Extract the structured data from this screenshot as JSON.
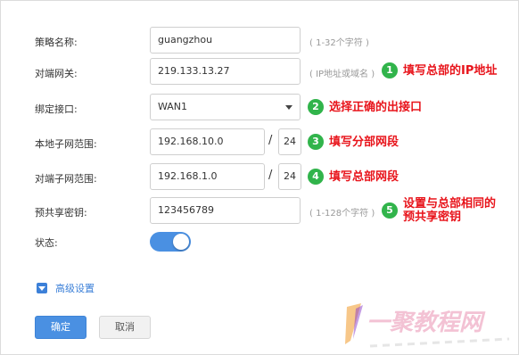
{
  "form": {
    "fields": [
      {
        "label": "策略名称:",
        "value": "guangzhou",
        "hint": "( 1-32个字符 )"
      },
      {
        "label": "对端网关:",
        "value": "219.133.13.27",
        "hint": "( IP地址或域名 )"
      },
      {
        "label": "绑定接口:",
        "value": "WAN1"
      },
      {
        "label": "本地子网范围:",
        "value": "192.168.10.0",
        "mask": "24"
      },
      {
        "label": "对端子网范围:",
        "value": "192.168.1.0",
        "mask": "24"
      },
      {
        "label": "预共享密钥:",
        "value": "123456789",
        "hint": "( 1-128个字符 )"
      },
      {
        "label": "状态:"
      }
    ],
    "status_on": true,
    "advanced_label": "高级设置",
    "ok_label": "确定",
    "cancel_label": "取消"
  },
  "annotations": [
    {
      "num": "1",
      "text": "填写总部的IP地址"
    },
    {
      "num": "2",
      "text": "选择正确的出接口"
    },
    {
      "num": "3",
      "text": "填写分部网段"
    },
    {
      "num": "4",
      "text": "填写总部网段"
    },
    {
      "num": "5",
      "line1": "设置与总部相同的",
      "line2": "预共享密钥"
    }
  ],
  "watermark": {
    "text": "一聚教程网"
  },
  "colors": {
    "accent": "#4a90e2",
    "annotation_red": "#e8141b",
    "badge_green": "#31b44b"
  }
}
